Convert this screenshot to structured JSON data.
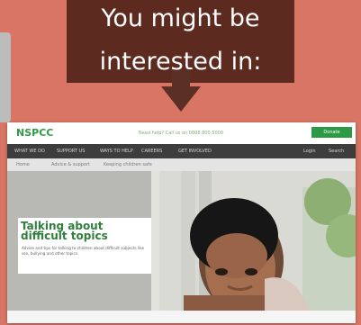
{
  "callout": {
    "line1": "You might be",
    "line2": "interested in:"
  },
  "preview": {
    "logo": "NSPCC",
    "help_text": "Need help? Call us on 0808 800 5000",
    "donate_label": "Donate",
    "nav": [
      "WHAT WE DO",
      "SUPPORT US",
      "WAYS TO HELP",
      "CAREERS",
      "GET INVOLVED"
    ],
    "nav_right": [
      "Login",
      "Search"
    ],
    "breadcrumb": [
      "Home",
      "Advice & support",
      "Keeping children safe"
    ],
    "hero_title": "Talking about difficult topics",
    "hero_subtitle": "Advice and tips for talking to children about difficult subjects like sex, bullying and other topics."
  }
}
